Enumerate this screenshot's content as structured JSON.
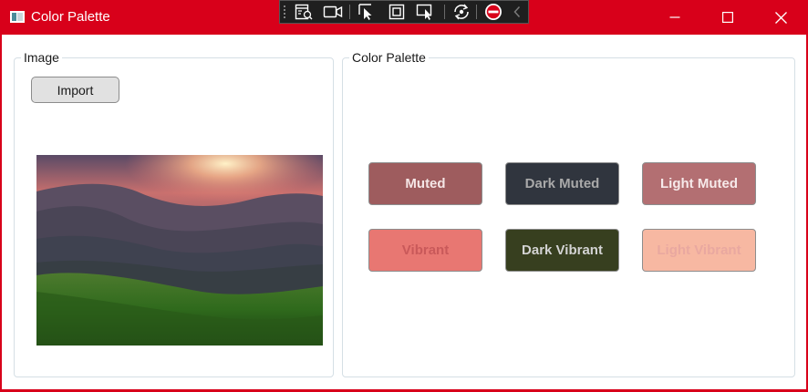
{
  "window": {
    "title": "Color Palette",
    "accent": "#d8001a"
  },
  "dev_toolbar": {
    "icons": [
      "live-visual-tree-icon",
      "record-icon",
      "select-element-icon",
      "display-layout-adorners-icon",
      "track-focus-icon",
      "hot-reload-icon",
      "stop-icon",
      "collapse-icon"
    ]
  },
  "window_controls": {
    "icons": [
      "minimize-icon",
      "maximize-icon",
      "close-icon"
    ]
  },
  "image_group": {
    "label": "Image",
    "import_label": "Import"
  },
  "palette_group": {
    "label": "Color Palette",
    "swatches": [
      {
        "label": "Muted",
        "bg": "#9e5c5e",
        "fg": "#f5e6e6"
      },
      {
        "label": "Dark Muted",
        "bg": "#30353e",
        "fg": "#a9a9a9"
      },
      {
        "label": "Light Muted",
        "bg": "#b36f72",
        "fg": "#f7eaea"
      },
      {
        "label": "Vibrant",
        "bg": "#e87772",
        "fg": "#c9595a"
      },
      {
        "label": "Dark Vibrant",
        "bg": "#373f1f",
        "fg": "#d3d3d3"
      },
      {
        "label": "Light Vibrant",
        "bg": "#f7b8a2",
        "fg": "#e9a8a0"
      }
    ]
  }
}
